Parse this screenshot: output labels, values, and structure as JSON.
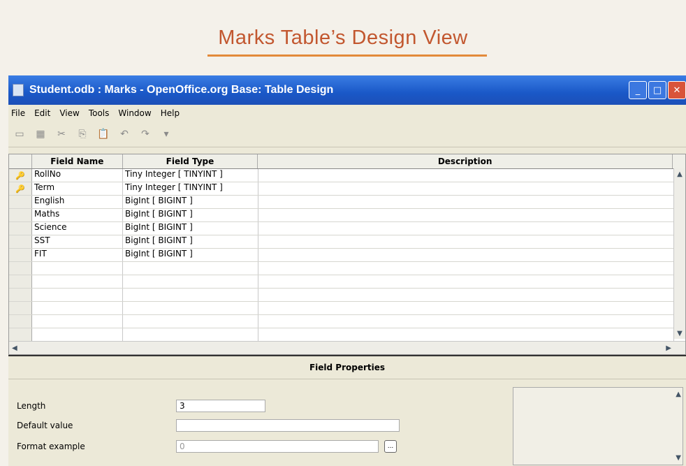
{
  "page_heading": "Marks Table’s Design View",
  "window": {
    "title": "Student.odb : Marks - OpenOffice.org Base: Table Design",
    "controls": {
      "minimize": "_",
      "maximize": "□",
      "close": "✕"
    }
  },
  "menu": [
    "File",
    "Edit",
    "View",
    "Tools",
    "Window",
    "Help"
  ],
  "toolbar": {
    "icons": [
      "save-icon",
      "edit-icon",
      "cut-icon",
      "copy-icon",
      "paste-icon",
      "undo-icon",
      "redo-icon",
      "dropdown-arrow-icon"
    ],
    "glyphs": [
      "▭",
      "▦",
      "✂",
      "⎘",
      "📋",
      "↶",
      "↷",
      "▾"
    ]
  },
  "grid": {
    "headers": {
      "name": "Field Name",
      "type": "Field Type",
      "description": "Description"
    },
    "rows": [
      {
        "name": "RollNo",
        "type": "Tiny Integer [ TINYINT ]",
        "key": "🔑"
      },
      {
        "name": "Term",
        "type": "Tiny Integer [ TINYINT ]",
        "key": "🔑"
      },
      {
        "name": "English",
        "type": "BigInt [ BIGINT ]",
        "key": ""
      },
      {
        "name": "Maths",
        "type": "BigInt [ BIGINT ]",
        "key": ""
      },
      {
        "name": "Science",
        "type": "BigInt [ BIGINT ]",
        "key": ""
      },
      {
        "name": "SST",
        "type": "BigInt [ BIGINT ]",
        "key": ""
      },
      {
        "name": "FIT",
        "type": "BigInt [ BIGINT ]",
        "key": ""
      },
      {
        "name": "",
        "type": "",
        "key": ""
      },
      {
        "name": "",
        "type": "",
        "key": ""
      },
      {
        "name": "",
        "type": "",
        "key": ""
      },
      {
        "name": "",
        "type": "",
        "key": ""
      },
      {
        "name": "",
        "type": "",
        "key": ""
      },
      {
        "name": "",
        "type": "",
        "key": ""
      }
    ],
    "scroll_glyphs": {
      "up": "▲",
      "down": "▼",
      "left": "◀",
      "right": "▶"
    }
  },
  "field_properties": {
    "title": "Field Properties",
    "length_label": "Length",
    "length_value": "3",
    "default_label": "Default value",
    "default_value": "",
    "format_label": "Format example",
    "format_value": "0",
    "format_button": "..."
  },
  "colors": {
    "titlebar": "#1a58c7",
    "heading": "#c2572f",
    "key_icon": "#c89414"
  }
}
